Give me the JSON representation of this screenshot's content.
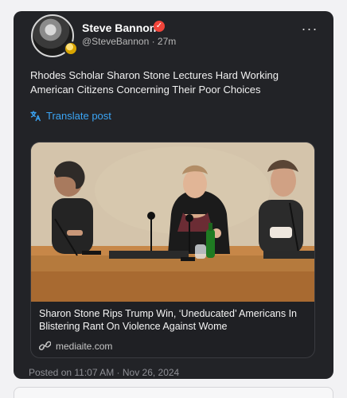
{
  "post": {
    "author": {
      "display_name": "Steve Bannon",
      "handle_time": "@SteveBannon · 27m",
      "verified_icon": "check-badge-icon",
      "avatar_badge_icon": "gold-badge-icon"
    },
    "more_icon": "more-horizontal-icon",
    "more_label": "···",
    "text": "Rhodes Scholar Sharon Stone Lectures Hard Working American Citizens Concerning Their Poor Choices",
    "translate_label": "Translate post",
    "translate_icon": "translate-icon",
    "link_card": {
      "title": "Sharon Stone Rips Trump Win, ‘Uneducated’ Americans In Blistering Rant On Violence Against Wome",
      "domain": "mediaite.com",
      "link_icon": "link-icon"
    },
    "posted_time": "Posted on 11:07 AM · Nov 26, 2024"
  },
  "colors": {
    "card_background": "#222327",
    "page_background": "#f2f2f4",
    "accent_blue": "#3ba5f5",
    "verified_red": "#f0443a"
  }
}
